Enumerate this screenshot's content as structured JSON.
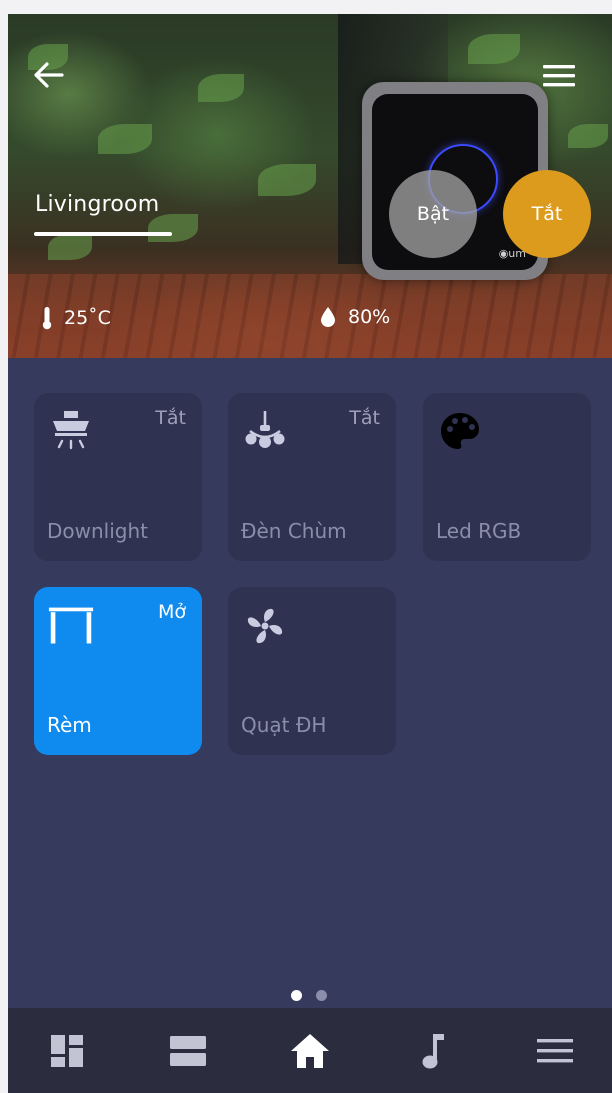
{
  "header": {
    "room_name": "Livingroom",
    "back_icon": "arrow-left-icon",
    "menu_icon": "hamburger-menu-icon"
  },
  "master_controls": {
    "on_label": "Bật",
    "off_label": "Tắt",
    "off_color": "#dc9b1d"
  },
  "climate": {
    "temperature": "25˚C",
    "humidity": "80%",
    "temperature_icon": "thermometer-icon",
    "humidity_icon": "water-drop-icon"
  },
  "devices": [
    {
      "label": "Downlight",
      "status": "Tắt",
      "icon": "downlight-icon",
      "active": false
    },
    {
      "label": "Đèn Chùm",
      "status": "Tắt",
      "icon": "chandelier-icon",
      "active": false
    },
    {
      "label": "Led RGB",
      "status": "",
      "icon": "palette-icon",
      "active": false
    },
    {
      "label": "Rèm",
      "status": "Mở",
      "icon": "curtain-icon",
      "active": true
    },
    {
      "label": "Quạt ĐH",
      "status": "",
      "icon": "fan-icon",
      "active": false
    }
  ],
  "pager": {
    "pages": 2,
    "current": 1
  },
  "bottom_nav": [
    {
      "icon": "dashboard-icon",
      "active": false
    },
    {
      "icon": "scenes-icon",
      "active": false
    },
    {
      "icon": "home-icon",
      "active": true
    },
    {
      "icon": "music-note-icon",
      "active": false
    },
    {
      "icon": "menu-list-icon",
      "active": false
    }
  ],
  "colors": {
    "background": "#363a5c",
    "tile": "#2f3351",
    "tile_active": "#0f8bf0",
    "nav_bar": "#2b2c3d",
    "accent_off": "#dc9b1d"
  }
}
